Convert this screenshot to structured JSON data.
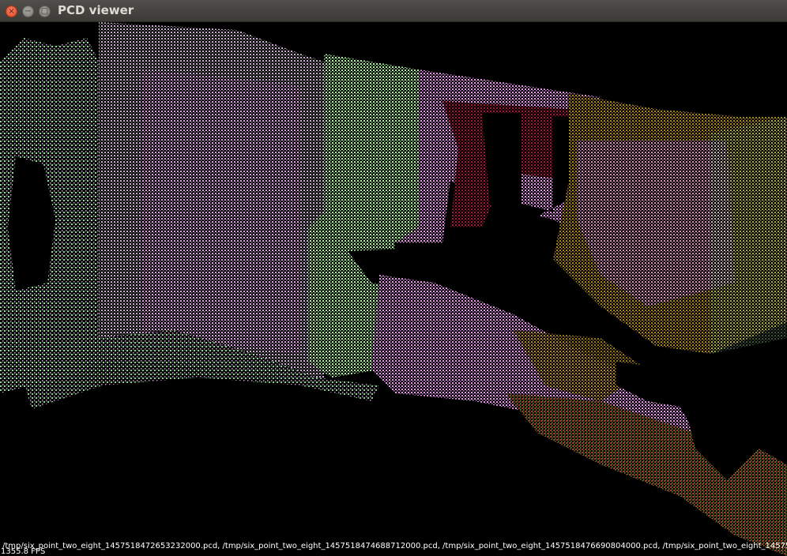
{
  "window": {
    "title": "PCD viewer",
    "controls": {
      "close": "×",
      "minimize": "−",
      "maximize": "□"
    }
  },
  "viewer": {
    "background": "#000000",
    "cloud_colors": [
      "#e69ae6",
      "#b3f0a6",
      "#a01c32",
      "#9c8a1a",
      "#2a8a50",
      "#6a6a6a"
    ],
    "loaded_files_text": "/tmp/six_point_two_eight_1457518472653232000.pcd, /tmp/six_point_two_eight_1457518474688712000.pcd, /tmp/six_point_two_eight_1457518476690804000.pcd, /tmp/six_point_two_eight_145751847",
    "fps_text": "1355.8 FPS"
  }
}
